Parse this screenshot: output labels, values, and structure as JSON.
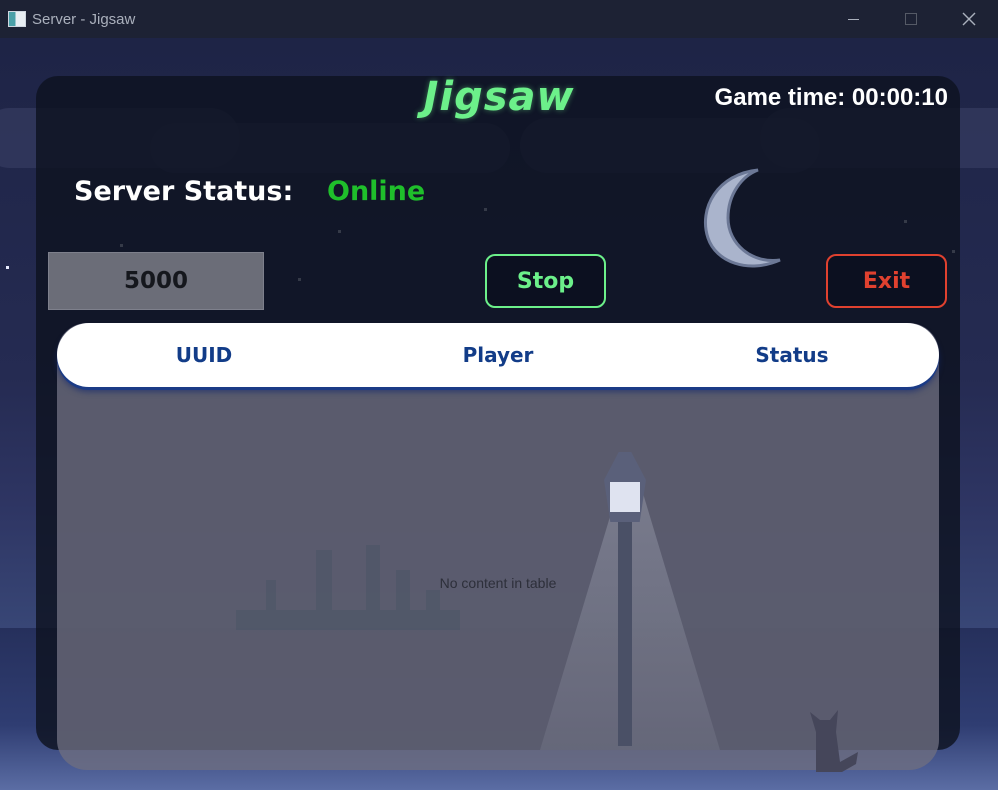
{
  "window": {
    "title": "Server - Jigsaw",
    "controls": [
      "minimize",
      "maximize",
      "close"
    ]
  },
  "header": {
    "app_title": "Jigsaw",
    "game_time": "Game time: 00:00:10"
  },
  "server": {
    "status_label": "Server Status:",
    "status_value": "Online"
  },
  "controls": {
    "port_value": "5000",
    "stop_label": "Stop",
    "exit_label": "Exit"
  },
  "table": {
    "columns": [
      "UUID",
      "Player",
      "Status"
    ],
    "rows": [],
    "empty_message": "No content in table"
  },
  "colors": {
    "title": "#6cf08a",
    "online": "#1fbf2b",
    "stop": "#6cf08a",
    "exit": "#e0412f",
    "header_text": "#123c88"
  },
  "icons": {
    "app": "server-app-icon",
    "close": "close-icon",
    "moon": "moon-icon"
  }
}
